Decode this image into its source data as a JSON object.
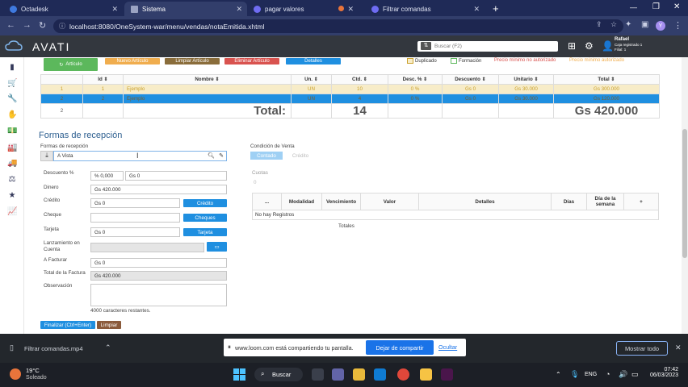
{
  "browser": {
    "tabs": [
      {
        "title": "Octadesk",
        "color": "#3f7ae0"
      },
      {
        "title": "Sistema",
        "color": "#9aa3c2",
        "active": true
      },
      {
        "title": "pagar valores",
        "color": "#6f6cf2"
      },
      {
        "title": "Filtrar comandas",
        "color": "#6f6cf2"
      }
    ],
    "url": "localhost:8080/OneSystem-war/menu/vendas/notaEmitida.xhtml",
    "profile_initial": "Y"
  },
  "header": {
    "logo": "AVATI",
    "search_placeholder": "Buscar (F2)",
    "user_name": "Rafael",
    "user_line1": "Caja registrado 1",
    "user_line2": "Filial: 1"
  },
  "toolbar": {
    "buttons": [
      {
        "label": "Artículo",
        "color": "#5cb85c"
      },
      {
        "label": "Nuevo Artículo",
        "color": "#f0ad4e"
      },
      {
        "label": "Limpiar Artículo",
        "color": "#8a6d3b"
      },
      {
        "label": "Eliminar Artículo",
        "color": "#d9534f"
      },
      {
        "label": "Detalles",
        "color": "#1f8fe0"
      }
    ],
    "legend": {
      "duplicado": "Duplicado",
      "formacion": "Formación",
      "precio_min": "Precio mínimo no autorizado",
      "precio_min2": "Precio mínimo autorizado"
    }
  },
  "items_table": {
    "headers": [
      "Id",
      "Nombre",
      "Un.",
      "Ctd.",
      "Desc. %",
      "Descuento",
      "Unitario",
      "Total"
    ],
    "rows": [
      [
        "1",
        "1",
        "Ejemplo",
        "UN",
        "10",
        "0 %",
        "Gs 0",
        "Gs 30.000",
        "Gs 300.000"
      ],
      [
        "2",
        "2",
        "Ejemplo",
        "UN",
        "4",
        "0 %",
        "Gs 0",
        "Gs 30.000",
        "Gs 120.000"
      ]
    ],
    "summary": {
      "row_num": "2",
      "total_label": "Total:",
      "qty": "14",
      "amount": "Gs 420.000"
    }
  },
  "reception": {
    "title": "Formas de recepción",
    "form_label": "Formas de recepción",
    "form_value": "A Vista",
    "discount_label": "Descuento %",
    "discount_pct": "% 0,000",
    "discount_amt": "Gs 0",
    "dinero_label": "Dinero",
    "dinero_value": "Gs 420.000",
    "credito_label": "Crédito",
    "credito_value": "Gs 0",
    "credito_btn": "Crédito",
    "cheque_label": "Cheque",
    "cheque_value": "",
    "cheques_btn": "Cheques",
    "tarjeta_label": "Tarjeta",
    "tarjeta_value": "Gs 0",
    "tarjeta_btn": "Tarjeta",
    "lanzamiento_label1": "Lanzamiento en",
    "lanzamiento_label2": "Cuenta",
    "a_facturar_label": "A Facturar",
    "a_facturar_value": "Gs 0",
    "total_factura_label": "Total de la Factura",
    "total_factura_value": "Gs 420.000",
    "observacion_label": "Observación",
    "chars_left": "4000 caracteres restantes.",
    "finalize_btn": "Finalizar (Ctrl+Enter)",
    "clear_btn": "Limpiar"
  },
  "condition": {
    "label": "Condición de Venta",
    "contado": "Contado",
    "credito": "Crédito",
    "cuotas_label": "Cuotas",
    "cuotas_value": "0"
  },
  "installments_table": {
    "headers": [
      "...",
      "Modalidad",
      "Vencimiento",
      "Valor",
      "Detalles",
      "Días",
      "Día de la semana",
      "+"
    ],
    "empty": "No hay Registros",
    "totals": "Totales"
  },
  "shelf": {
    "download": "Filtrar comandas.mp4",
    "share_msg": "www.loom.com está compartiendo tu pantalla.",
    "stop_btn": "Dejar de compartir",
    "hide_link": "Ocultar",
    "show_all": "Mostrar todo"
  },
  "taskbar": {
    "temp": "19°C",
    "weather": "Soleado",
    "search": "Buscar",
    "lang": "ENG",
    "time": "07:42",
    "date": "06/03/2023"
  }
}
